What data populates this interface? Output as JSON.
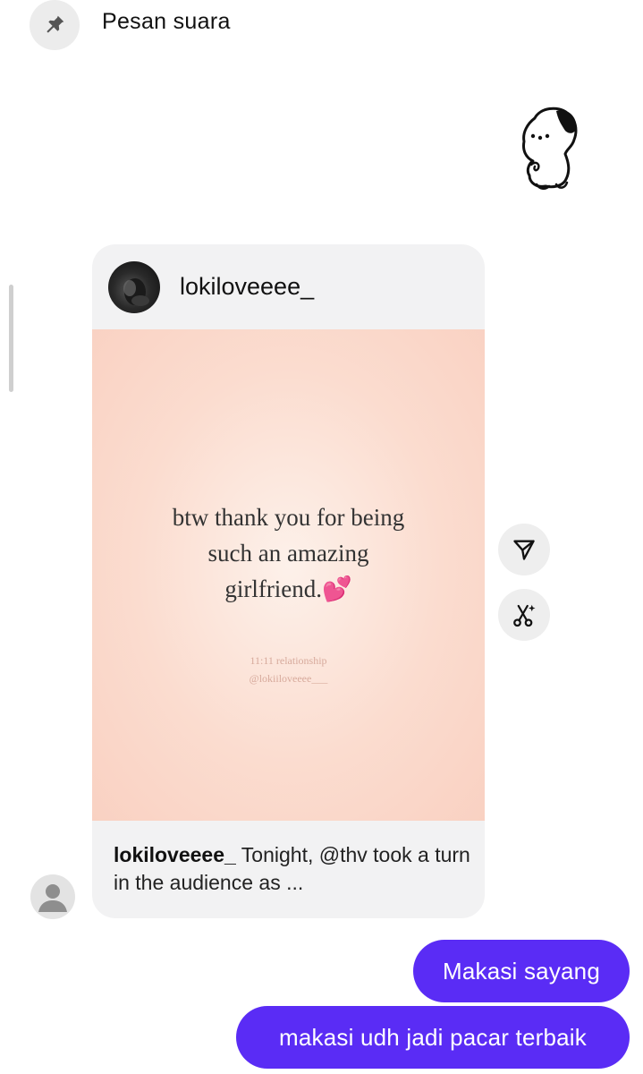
{
  "pinned": {
    "icon": "pin-icon",
    "label": "Pesan suara"
  },
  "sticker": {
    "icon": "puppy-sticker"
  },
  "shared_post": {
    "username": "lokiloveeee_",
    "quote_lines": [
      "btw thank you for being",
      "such an amazing",
      "girlfriend.💕"
    ],
    "watermark_lines": [
      "11:11 relationship",
      "@lokiiloveeee___"
    ],
    "caption_user": "lokiloveeee_",
    "caption_text": " Tonight, @thv took a turn in the audience as ..."
  },
  "actions": {
    "send_icon": "send-icon",
    "remix_icon": "remix-icon"
  },
  "messages": [
    {
      "text": "Makasi sayang"
    },
    {
      "text": "makasi udh jadi pacar terbaik"
    }
  ],
  "colors": {
    "bubble": "#5a2cf5",
    "card": "#f2f2f3",
    "post_bg": "#f9d1c2"
  }
}
